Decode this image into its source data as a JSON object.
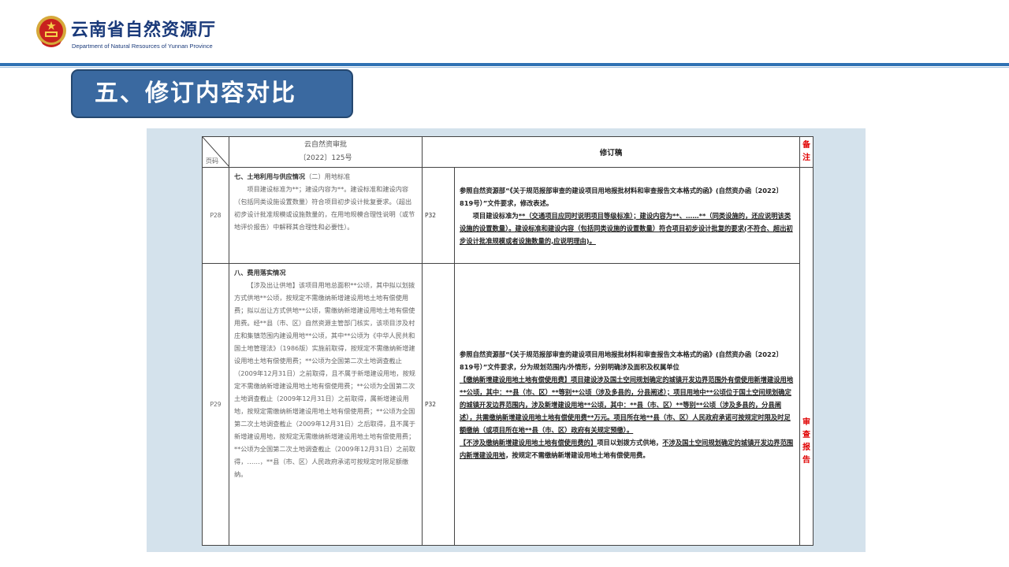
{
  "header": {
    "org_name_cn": "云南省自然资源厅",
    "org_name_en": "Department of Natural Resources of Yunnan Province"
  },
  "section_title": "五、修订内容对比",
  "table": {
    "header": {
      "page_label": "页码",
      "old_line1": "云自然资审批",
      "old_line2": "〔2022〕125号",
      "new": "修订稿",
      "note_line1": "备",
      "note_line2": "注"
    },
    "rows": [
      {
        "old_page": "P28",
        "old_title": "七、土地利用与供应情况",
        "old_title_rest": "（二）用地标准",
        "old_body": "项目建设标准为**；建设内容为**。建设标准和建设内容（包括同类设施设置数量）符合项目初步设计批复要求。（超出初步设计批准规模或设施数量的，在用地规模合理性说明（或节地评价报告）中解释其合理性和必要性）。",
        "new_page": "P32",
        "new_p1": "参照自然资源部“《关于规范报部审查的建设项目用地报批材料和审查报告文本格式的函》(自然资办函〔2022〕819号）”文件要求，修改表述。",
        "new_p2a": "项目建设标准为",
        "new_p2b": "**（交通项目应同时说明项目等级标准）；建设内容为**、……**（同类设施的，还应说明该类设施的设置数量）。建设标准和建设内容（包括同类设施的设置数量）符合项目初步设计批复的要求(不符合、超出初步设计批准规模或者设施数量的,应说明理由)。"
      },
      {
        "old_page": "P29",
        "old_title": "八、费用落实情况",
        "old_body": "【涉及出让供地】该项目用地总面积**公顷，其中拟以划拨方式供地**公顷，按规定不需缴纳新增建设用地土地有偿使用费；拟以出让方式供地**公顷，需缴纳新增建设用地土地有偿使用费。经**县（市、区）自然资源主管部门核实，该项目涉及村庄和集镇范围内建设用地**公顷，其中**公顷为《中华人民共和国土地管理法》（1986版）实施前取得，按规定不需缴纳新增建设用地土地有偿使用费；**公顷为全国第二次土地调查截止（2009年12月31日）之前取得，且不属于新增建设用地，按规定不需缴纳新增建设用地土地有偿使用费；**公顷为全国第二次土地调查截止（2009年12月31日）之前取得，属新增建设用地，按规定需缴纳新增建设用地土地有偿使用费；**公顷为全国第二次土地调查截止（2009年12月31日）之后取得，且不属于新增建设用地，按规定无需缴纳新增建设用地土地有偿使用费；**公顷为全国第二次土地调查截止（2009年12月31日）之前取得，……，**县（市、区）人民政府承诺可按规定时限足额缴纳。",
        "new_page": "P32",
        "new_p1": "参照自然资源部“《关于规范报部审查的建设项目用地报批材料和审查报告文本格式的函》(自然资办函〔2022〕819号）”文件要求，分为规划范围内/外情形，分别明确涉及面积及权属单位",
        "new_p2": "【缴纳新增建设用地土地有偿使用费】项目建设涉及国土空间规划确定的城镇开发边界范围外有偿使用新增建设用地**公顷，其中：**县（市、区）**等别**公顷（涉及多县的，分县阐述）；项目用地中**公顷位于国土空间规划确定的城镇开发边界范围内，涉及新增建设用地**公顷，其中：**县（市、区）**等别**公顷（涉及多县的，分县阐述），共需缴纳新增建设用地土地有偿使用费**万元。项目所在地**县（市、区）人民政府承诺可按规定时限及时足额缴纳（或项目所在地**县（市、区）政府有关规定预缴）。",
        "new_p3a": "【不涉及缴纳新增建设用地土地有偿使用费的】",
        "new_p3b": "项目以划拨方式供地，",
        "new_p3c": "不涉及国土空间规划确定的城镇开发边界范围内新增建设用地",
        "new_p3d": "，按规定不需缴纳新增建设用地土地有偿使用费。"
      }
    ],
    "note": [
      "审",
      "查",
      "报",
      "告"
    ]
  }
}
